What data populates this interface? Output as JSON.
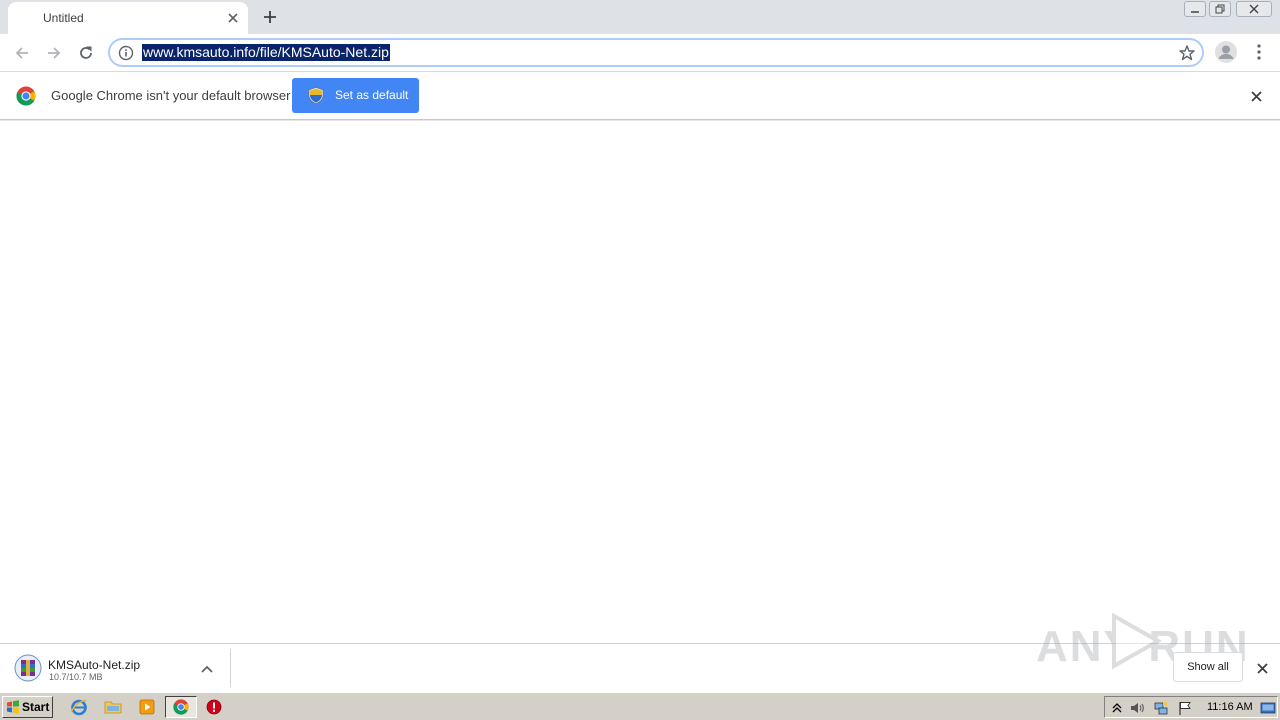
{
  "tab": {
    "title": "Untitled"
  },
  "omnibox": {
    "url": "www.kmsauto.info/file/KMSAuto-Net.zip"
  },
  "infobar": {
    "message": "Google Chrome isn't your default browser",
    "button_label": "Set as default"
  },
  "download": {
    "filename": "KMSAuto-Net.zip",
    "progress_text": "10.7/10.7 MB",
    "show_all_label": "Show all"
  },
  "taskbar": {
    "start_label": "Start",
    "clock": "11:16 AM"
  },
  "watermark": {
    "text": "ANY RUN"
  },
  "colors": {
    "accent": "#4285f4",
    "url_selection": "#0a246a",
    "tabstrip": "#dee1e6",
    "taskbar": "#d4d0c8"
  }
}
